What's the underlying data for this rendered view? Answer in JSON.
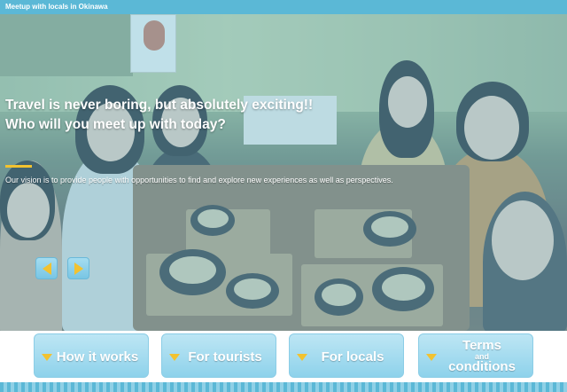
{
  "header": {
    "title": "Meetup with locals in Okinawa"
  },
  "hero": {
    "headline_line1": "Travel is never boring, but absolutely exciting!!",
    "headline_line2": "Who will you meet up with today?",
    "vision": "Our vision is to provide people with opportunities to find and explore new experiences as well as perspectives.",
    "prev_icon": "triangle-left-icon",
    "next_icon": "triangle-right-icon"
  },
  "nav": {
    "items": [
      {
        "label": "How it works",
        "icon": "triangle-down-icon"
      },
      {
        "label": "For tourists",
        "icon": "triangle-down-icon"
      },
      {
        "label": "For locals",
        "icon": "triangle-down-icon"
      },
      {
        "label_top": "Terms",
        "label_mid": "and",
        "label_bottom": "conditions",
        "icon": "triangle-down-icon"
      }
    ]
  },
  "colors": {
    "accent": "#5bb8d6",
    "button": "#8ed2eb",
    "arrow": "#f2c230",
    "underline": "#f2c230"
  }
}
